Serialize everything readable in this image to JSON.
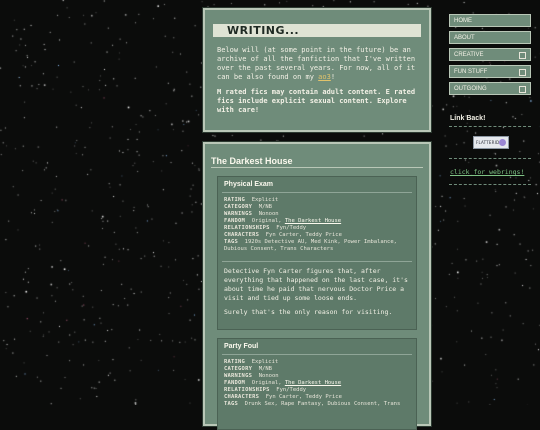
{
  "nav": {
    "items": [
      {
        "label": "HOME",
        "expandable": false
      },
      {
        "label": "ABOUT",
        "expandable": false
      },
      {
        "label": "CREATIVE",
        "expandable": true
      },
      {
        "label": "FUN STUFF",
        "expandable": true
      },
      {
        "label": "OUTGOING",
        "expandable": true
      }
    ],
    "link_back_title": "Link Back!",
    "button_text": "FLATTERIDEN",
    "webrings_link": "click for webrings!"
  },
  "writing": {
    "title": "WRITING...",
    "intro_1": "Below will (at some point in the future) be an archive of all the fanfiction that I've written over the past several years. For now, all of it can be also found on my ",
    "intro_1_link": "ao3",
    "intro_1_end": "!",
    "intro_2": "M rated fics may contain adult content. E rated fics include explicit sexual content. Explore with care!"
  },
  "section": {
    "title": "The Darkest House"
  },
  "labels": {
    "rating": "RATING",
    "category": "CATEGORY",
    "warnings": "WARNINGS",
    "fandom": "FANDOM",
    "relationships": "RELATIONSHIPS",
    "characters": "CHARACTERS",
    "tags": "TAGS"
  },
  "fics": [
    {
      "title": "Physical Exam",
      "rating": "Explicit",
      "category": "M/NB",
      "warnings": "Nonoon",
      "fandom_prefix": "Original, ",
      "fandom_link": "The Darkest House",
      "relationships": "Fyn/Teddy",
      "characters": "Fyn Carter, Teddy Price",
      "tags": "1920s Detective AU, Med Kink, Power Imbalance, Dubious Consent, Trans Characters",
      "summary_1": "Detective Fyn Carter figures that, after everything that happened on the last case, it's about time he paid that nervous Doctor Price a visit and tied up some loose ends.",
      "summary_2": "Surely that's the only reason for visiting."
    },
    {
      "title": "Party Foul",
      "rating": "Explicit",
      "category": "M/NB",
      "warnings": "Nonoon",
      "fandom_prefix": "Original, ",
      "fandom_link": "The Darkest House",
      "relationships": "Fyn/Teddy",
      "characters": "Fyn Carter, Teddy Price",
      "tags": "Drunk Sex, Rape Fantasy, Dubious Consent, Trans"
    }
  ]
}
